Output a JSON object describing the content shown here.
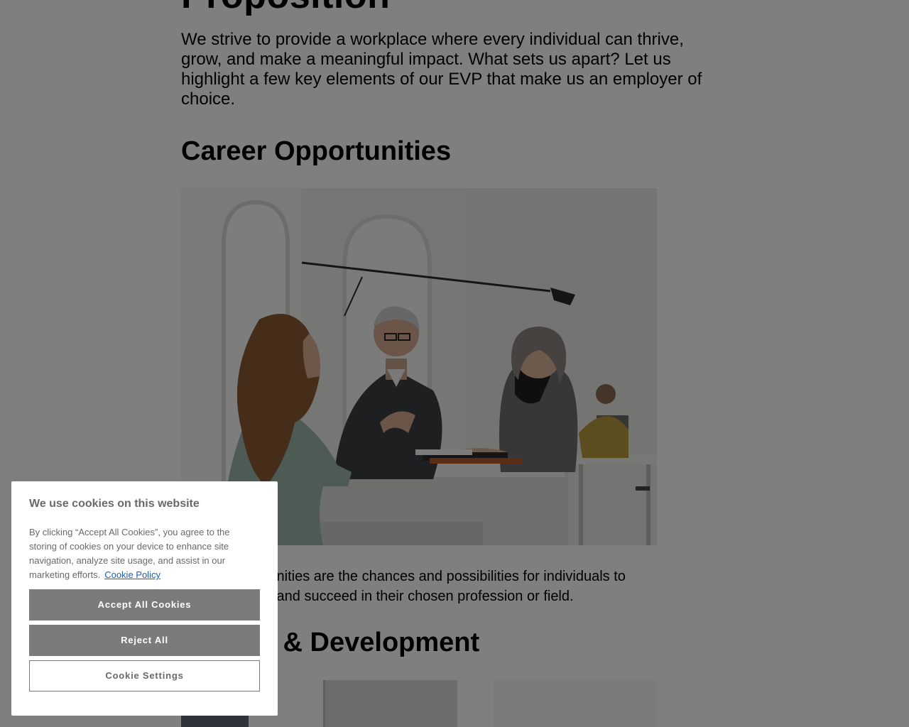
{
  "article": {
    "heading": "Proposition",
    "intro": "We strive to provide a workplace where every individual can thrive, grow, and make a meaningful impact. What sets us apart? Let us highlight a few key elements of our EVP that make us an employer of choice.",
    "career_heading": "Career Opportunities",
    "career_text": "Career opportunities are the chances and possibilities for individuals to grow, develop, and succeed in their chosen profession or field.",
    "growth_heading": "Growth & Development"
  },
  "cookie_banner": {
    "title": "We use cookies on this website",
    "description": "By clicking “Accept All Cookies”, you agree to the storing of cookies on your device to enhance site navigation, analyze site usage, and assist in our marketing efforts.",
    "policy_link": "Cookie Policy",
    "accept_label": "Accept All Cookies",
    "reject_label": "Reject All",
    "settings_label": "Cookie Settings"
  },
  "colors": {
    "overlay": "#000000",
    "button_fill": "#7d7a7a",
    "link": "#1a5fb4",
    "banner_text": "#696969"
  }
}
